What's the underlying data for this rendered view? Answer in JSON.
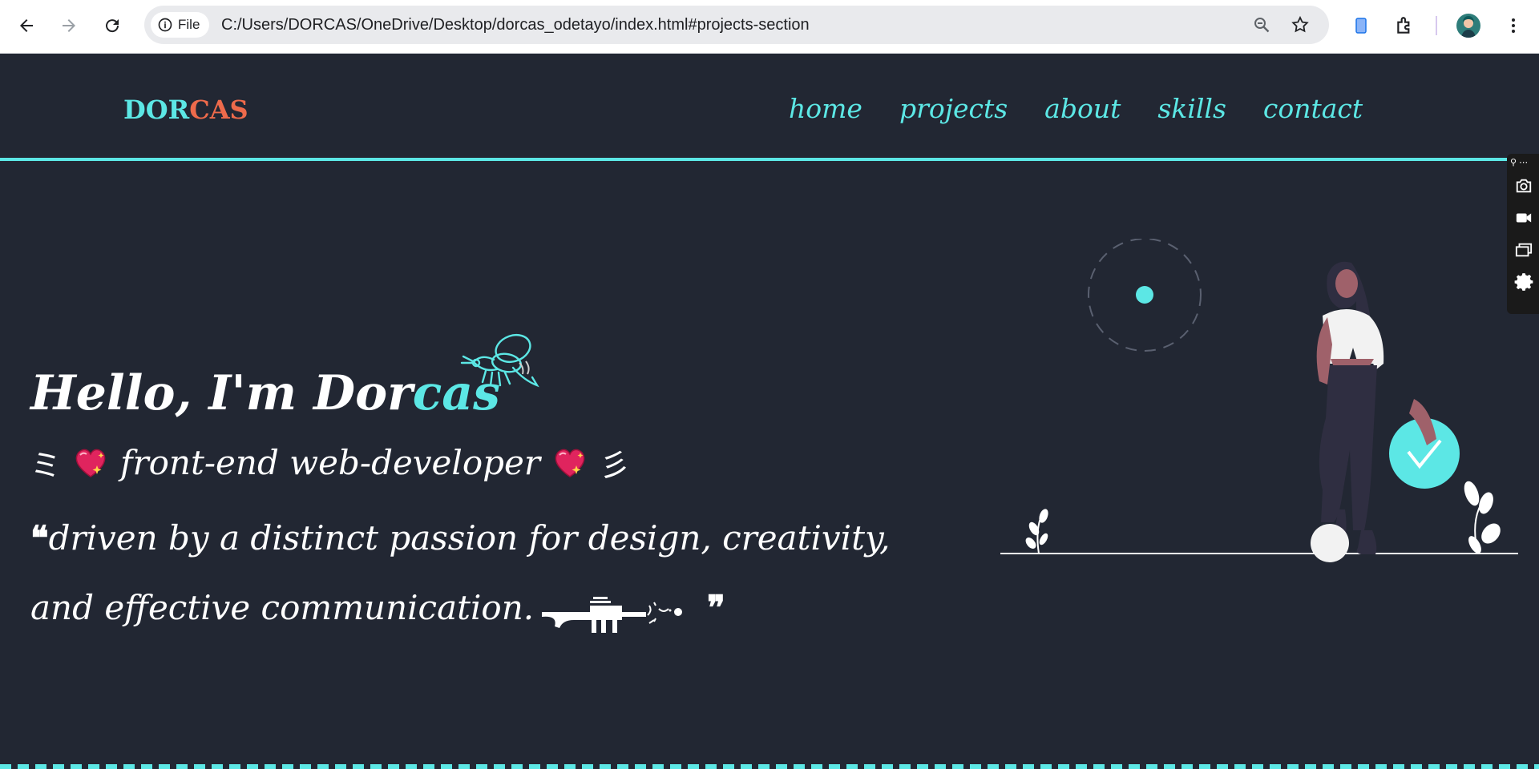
{
  "browser": {
    "file_chip_label": "File",
    "url": "C:/Users/DORCAS/OneDrive/Desktop/dorcas_odetayo/index.html#projects-section"
  },
  "site": {
    "logo_part1": "DOR",
    "logo_part2": "CAS",
    "nav": [
      "home",
      "projects",
      "about",
      "skills",
      "contact"
    ],
    "hero": {
      "greeting_main": "Hello, I'm Dor",
      "greeting_accent": "cas",
      "subtitle_left": "ミ",
      "subtitle": "front-end web-developer",
      "subtitle_right": "彡",
      "quote_open": "❝",
      "quote_text": "driven by a distinct passion for design, creativity, and effective communication.",
      "quote_close": "❞"
    }
  },
  "colors": {
    "background": "#222733",
    "accent": "#5ce7e5",
    "logo_secondary": "#ee6a4b",
    "text": "#ffffff"
  },
  "icons": [
    "back-arrow-icon",
    "forward-arrow-icon",
    "reload-icon",
    "info-icon",
    "zoom-icon",
    "star-icon",
    "bookmark-icon",
    "extensions-icon",
    "menu-dots-icon",
    "bee-icon",
    "heart-icon",
    "camera-icon",
    "video-icon",
    "gear-icon"
  ]
}
